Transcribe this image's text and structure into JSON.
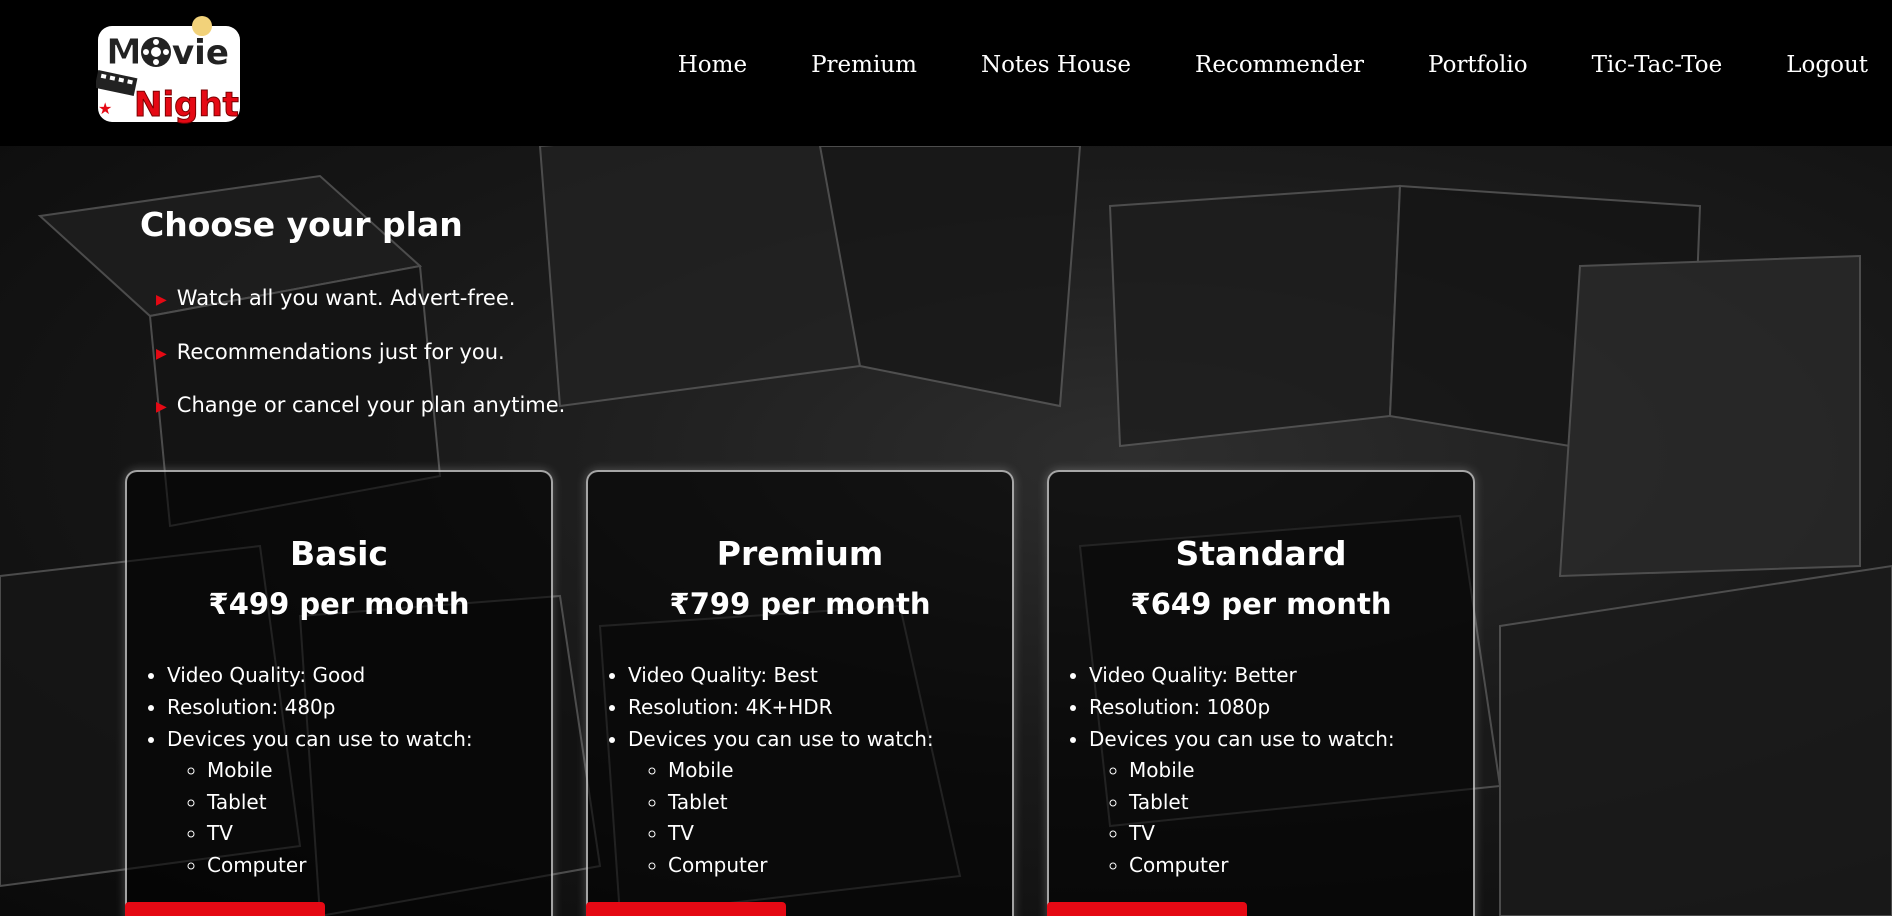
{
  "brand": {
    "logo_word1": "Movie",
    "logo_word2": "Night"
  },
  "nav": {
    "items": [
      "Home",
      "Premium",
      "Notes House",
      "Recommender",
      "Portfolio",
      "Tic-Tac-Toe",
      "Logout"
    ]
  },
  "hero": {
    "title": "Choose your plan",
    "perks": [
      "Watch all you want. Advert-free.",
      "Recommendations just for you.",
      "Change or cancel your plan anytime."
    ]
  },
  "plans": [
    {
      "name": "Basic",
      "price": "₹499 per month",
      "quality": "Video Quality: Good",
      "resolution": "Resolution: 480p",
      "devices_label": "Devices you can use to watch:",
      "devices": [
        "Mobile",
        "Tablet",
        "TV",
        "Computer"
      ]
    },
    {
      "name": "Premium",
      "price": "₹799 per month",
      "quality": "Video Quality: Best",
      "resolution": "Resolution: 4K+HDR",
      "devices_label": "Devices you can use to watch:",
      "devices": [
        "Mobile",
        "Tablet",
        "TV",
        "Computer"
      ]
    },
    {
      "name": "Standard",
      "price": "₹649 per month",
      "quality": "Video Quality: Better",
      "resolution": "Resolution: 1080p",
      "devices_label": "Devices you can use to watch:",
      "devices": [
        "Mobile",
        "Tablet",
        "TV",
        "Computer"
      ]
    }
  ],
  "colors": {
    "accent": "#e50914",
    "background": "#000000",
    "text": "#ffffff"
  }
}
